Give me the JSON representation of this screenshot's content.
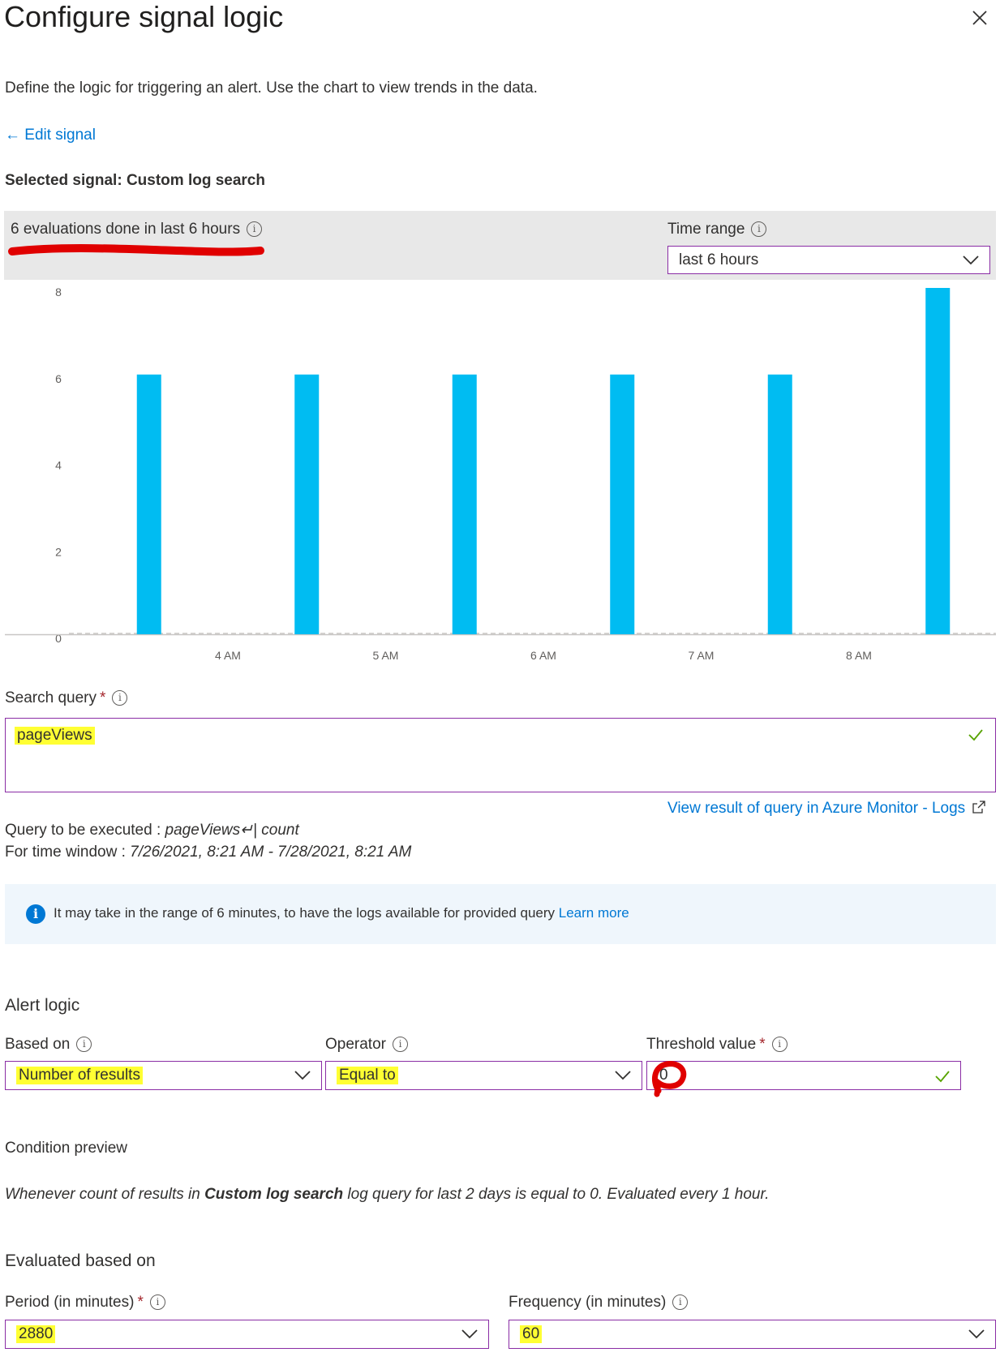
{
  "panel": {
    "title": "Configure signal logic",
    "description": "Define the logic for triggering an alert. Use the chart to view trends in the data.",
    "edit_signal": "← Edit signal",
    "selected_signal": "Selected signal: Custom log search"
  },
  "chart_header": {
    "evaluations": "6 evaluations done in last 6 hours",
    "time_range_label": "Time range",
    "time_range_value": "last 6 hours"
  },
  "chart_data": {
    "type": "bar",
    "categories": [
      "3:30 AM",
      "4:30 AM",
      "5:30 AM",
      "6:30 AM",
      "7:30 AM",
      "8:30 AM"
    ],
    "values": [
      6,
      6,
      6,
      6,
      6,
      8
    ],
    "ylim": [
      0,
      8
    ],
    "yticks": [
      "0",
      "2",
      "4",
      "6",
      "8"
    ],
    "xticks": [
      "4 AM",
      "5 AM",
      "6 AM",
      "7 AM",
      "8 AM"
    ],
    "bar_color": "#00bcf2",
    "grid": false
  },
  "query": {
    "label": "Search query",
    "required": "*",
    "value": "pageViews",
    "view_result_link": "View result of query in Azure Monitor - Logs",
    "executed_label": "Query to be executed : ",
    "executed_value": "pageViews↵| count",
    "window_label": "For time window : ",
    "window_value": "7/26/2021, 8:21 AM - 7/28/2021, 8:21 AM"
  },
  "banner": {
    "text": "It may take in the range of 6 minutes, to have the logs available for provided query",
    "link": "Learn more"
  },
  "alert_logic": {
    "title": "Alert logic",
    "based_on_label": "Based on",
    "based_on_value": "Number of results",
    "operator_label": "Operator",
    "operator_value": "Equal to",
    "threshold_label": "Threshold value",
    "threshold_required": "*",
    "threshold_value": "0"
  },
  "condition": {
    "title": "Condition preview",
    "text_before": "Whenever count of results in ",
    "text_bold": "Custom log search",
    "text_after": " log query for last 2 days is equal to 0. Evaluated every 1 hour."
  },
  "evaluation": {
    "title": "Evaluated based on",
    "period_label": "Period (in minutes)",
    "period_required": "*",
    "period_value": "2880",
    "frequency_label": "Frequency (in minutes)",
    "frequency_value": "60"
  },
  "colors": {
    "accent": "#0078d4",
    "border": "#8a2da5",
    "highlight": "#ffff33",
    "annotation": "#e00000",
    "success": "#57a300"
  }
}
